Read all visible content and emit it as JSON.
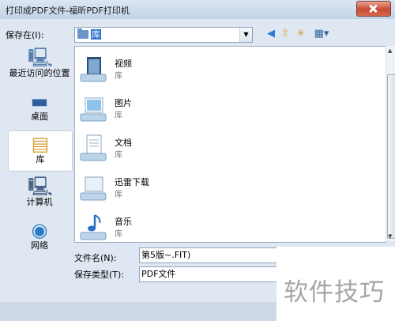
{
  "window": {
    "title": "打印成PDF文件-福昕PDF打印机"
  },
  "toolbar": {
    "save_in_label": "保存在(I):",
    "path_value": "库",
    "back_icon": "back-arrow-icon",
    "up_icon": "up-folder-icon",
    "new_folder_icon": "new-folder-icon",
    "view_icon": "view-menu-icon"
  },
  "sidebar": {
    "items": [
      {
        "label": "最近访问的位置",
        "icon": "recent-places-icon"
      },
      {
        "label": "桌面",
        "icon": "desktop-icon"
      },
      {
        "label": "库",
        "icon": "libraries-icon",
        "selected": true
      },
      {
        "label": "计算机",
        "icon": "computer-icon"
      },
      {
        "label": "网络",
        "icon": "network-icon"
      }
    ]
  },
  "files": [
    {
      "name": "视频",
      "type": "库",
      "icon": "video-library-icon"
    },
    {
      "name": "图片",
      "type": "库",
      "icon": "pictures-library-icon"
    },
    {
      "name": "文档",
      "type": "库",
      "icon": "documents-library-icon"
    },
    {
      "name": "迅雷下载",
      "type": "库",
      "icon": "library-icon"
    },
    {
      "name": "音乐",
      "type": "库",
      "icon": "music-library-icon"
    }
  ],
  "form": {
    "filename_label": "文件名(N):",
    "filename_value": "第5版~.FIT)",
    "filetype_label": "保存类型(T):",
    "filetype_value": "PDF文件"
  },
  "watermark": {
    "text": "软件技巧"
  },
  "colors": {
    "accent": "#3075d2",
    "close": "#c74a33"
  }
}
